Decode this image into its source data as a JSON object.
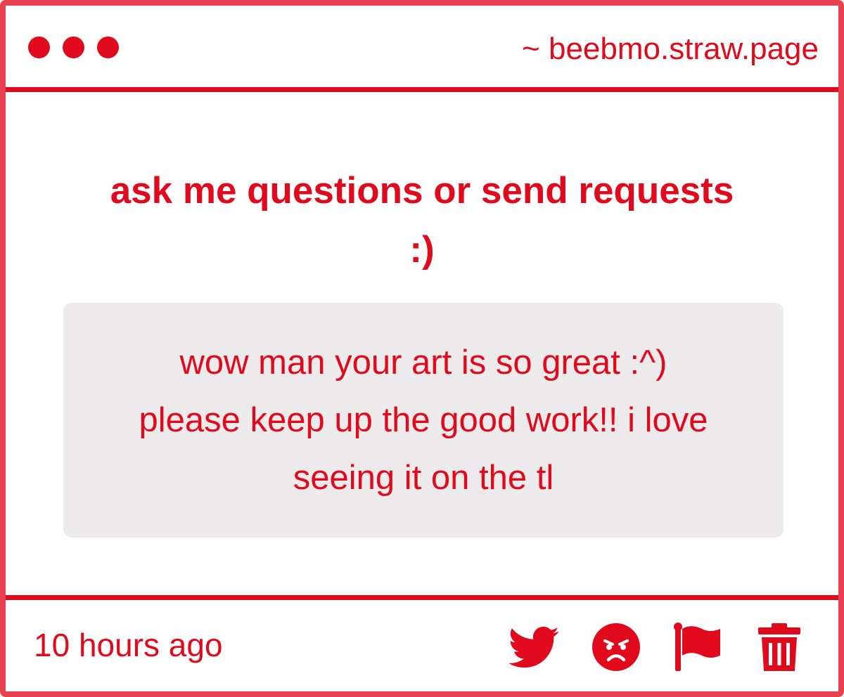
{
  "window": {
    "url": "~ beebmo.straw.page"
  },
  "prompt": {
    "line1": "ask me questions or send requests",
    "line2": ":)"
  },
  "message": {
    "text": "wow man your art is so great :^) please keep up the good work!! i love seeing it on the tl"
  },
  "footer": {
    "timestamp": "10 hours ago",
    "actions": [
      {
        "icon": "twitter-bird-icon"
      },
      {
        "icon": "angry-face-icon"
      },
      {
        "icon": "flag-icon"
      },
      {
        "icon": "trash-icon"
      }
    ]
  },
  "colors": {
    "accent": "#e00a1c",
    "border": "#ea4152",
    "message_bg": "#eceaeb",
    "background": "#ffffff"
  }
}
